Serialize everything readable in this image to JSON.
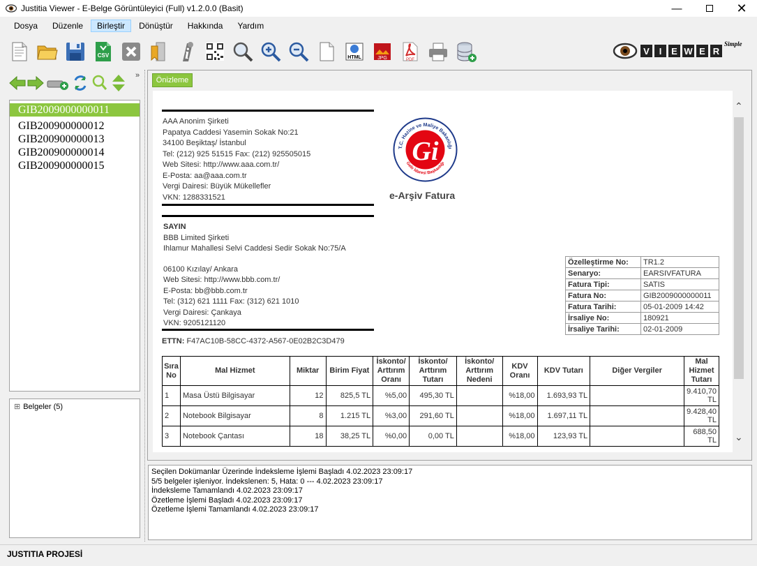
{
  "window": {
    "title": "Justitia Viewer -  E-Belge Görüntüleyici (Full) v1.2.0.0 (Basit)"
  },
  "menu": [
    "Dosya",
    "Düzenle",
    "Birleştir",
    "Dönüştür",
    "Hakkında",
    "Yardım"
  ],
  "toolbar_icons": [
    "new-document-icon",
    "open-folder-icon",
    "save-icon",
    "export-csv-icon",
    "close-icon",
    "bookmark-icon",
    "info-icon",
    "qr-code-icon",
    "search-icon",
    "zoom-in-icon",
    "zoom-out-icon",
    "page-icon",
    "export-html-icon",
    "export-jpg-icon",
    "export-pdf-icon",
    "print-icon",
    "database-add-icon"
  ],
  "toolbar_labels": {
    "csv": "CSV",
    "html": "HTML",
    "jpg": "JPG",
    "pdf": "PDF"
  },
  "logo": {
    "text": "VIEWER",
    "sup": "Simple"
  },
  "documents": [
    "GIB2009000000011",
    "GIB200900000012",
    "GIB200900000013",
    "GIB200900000014",
    "GIB200900000015"
  ],
  "tree": {
    "toggle": "⊞",
    "label": "Belgeler (5)"
  },
  "tab": "Önizleme",
  "seller": {
    "name": "AAA Anonim Şirketi",
    "address": "Papatya Caddesi Yasemin Sokak  No:21",
    "city": "34100 Beşiktaş/ İstanbul",
    "tel": "Tel: (212) 925 51515 Fax: (212) 925505015",
    "web": "Web Sitesi: http://www.aaa.com.tr/",
    "email": "E-Posta: aa@aaa.com.tr",
    "tax_office": "Vergi Dairesi: Büyük Mükellefler",
    "vkn": "VKN: 1288331521"
  },
  "seal": {
    "top_text": "T.C. Hazine ve Maliye Bakanlığı",
    "bottom_text": "Gelir İdaresi Başkanlığı",
    "letters": "Gi"
  },
  "doc_title": "e-Arşiv Fatura",
  "buyer": {
    "heading": "SAYIN",
    "name": "BBB Limited Şirketi",
    "address": "Ihlamur Mahallesi Selvi Caddesi Sedir Sokak  No:75/A",
    "city": "06100 Kızılay/ Ankara",
    "web": "Web Sitesi: http://www.bbb.com.tr/",
    "email": "E-Posta: bb@bbb.com.tr",
    "tel": "Tel: (312) 621 1111 Fax: (312) 621 1010",
    "tax_office": "Vergi Dairesi: Çankaya",
    "vkn": "VKN: 9205121120"
  },
  "ettn": {
    "label": "ETTN:",
    "value": "F47AC10B-58CC-4372-A567-0E02B2C3D479"
  },
  "meta": [
    {
      "k": "Özelleştirme No:",
      "v": "TR1.2"
    },
    {
      "k": "Senaryo:",
      "v": "EARSIVFATURA"
    },
    {
      "k": "Fatura Tipi:",
      "v": "SATIS"
    },
    {
      "k": "Fatura No:",
      "v": "GIB2009000000011"
    },
    {
      "k": "Fatura Tarihi:",
      "v": "05-01-2009 14:42"
    },
    {
      "k": "İrsaliye No:",
      "v": "180921"
    },
    {
      "k": "İrsaliye Tarihi:",
      "v": "02-01-2009"
    }
  ],
  "table": {
    "headers": [
      "Sıra No",
      "Mal Hizmet",
      "Miktar",
      "Birim Fiyat",
      "İskonto/ Arttırım Oranı",
      "İskonto/ Arttırım Tutarı",
      "İskonto/ Arttırım Nedeni",
      "KDV Oranı",
      "KDV Tutarı",
      "Diğer Vergiler",
      "Mal Hizmet Tutarı"
    ],
    "rows": [
      [
        "1",
        "Masa Üstü Bilgisayar",
        "12",
        "825,5 TL",
        "%5,00",
        "495,30 TL",
        "",
        "%18,00",
        "1.693,93 TL",
        "",
        "9.410,70 TL"
      ],
      [
        "2",
        "Notebook Bilgisayar",
        "8",
        "1.215 TL",
        "%3,00",
        "291,60 TL",
        "",
        "%18,00",
        "1.697,11 TL",
        "",
        "9.428,40 TL"
      ],
      [
        "3",
        "Notebook Çantası",
        "18",
        "38,25 TL",
        "%0,00",
        "0,00 TL",
        "",
        "%18,00",
        "123,93 TL",
        "",
        "688,50 TL"
      ]
    ]
  },
  "log": [
    "Seçilen Dokümanlar Üzerinde İndeksleme İşlemi Başladı 4.02.2023 23:09:17",
    "5/5 belgeler işleniyor. İndekslenen: 5, Hata: 0 --- 4.02.2023 23:09:17",
    "İndeksleme Tamamlandı 4.02.2023 23:09:17",
    "Özetleme İşlemi Başladı 4.02.2023 23:09:17",
    "Özetleme İşlemi Tamamlandı 4.02.2023 23:09:17"
  ],
  "status": "JUSTITIA PROJESİ",
  "colors": {
    "accent": "#8cc63f",
    "seal_red": "#e30613",
    "seal_blue": "#1e3a8a"
  }
}
